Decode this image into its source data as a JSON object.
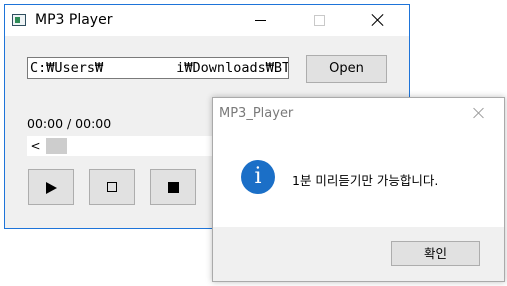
{
  "main_window": {
    "title": "MP3 Player",
    "path_value": "C:₩Users₩         i₩Downloads₩BTS",
    "open_label": "Open",
    "time_label": "00:00 / 00:00",
    "seek_arrow": "<",
    "seek_position": 0
  },
  "message_box": {
    "title": "MP3_Player",
    "icon": "info-icon",
    "icon_glyph": "i",
    "message": "1분 미리듣기만 가능합니다.",
    "ok_label": "확인"
  },
  "colors": {
    "window_border": "#1e74d9",
    "info_icon": "#1b6fc7"
  }
}
